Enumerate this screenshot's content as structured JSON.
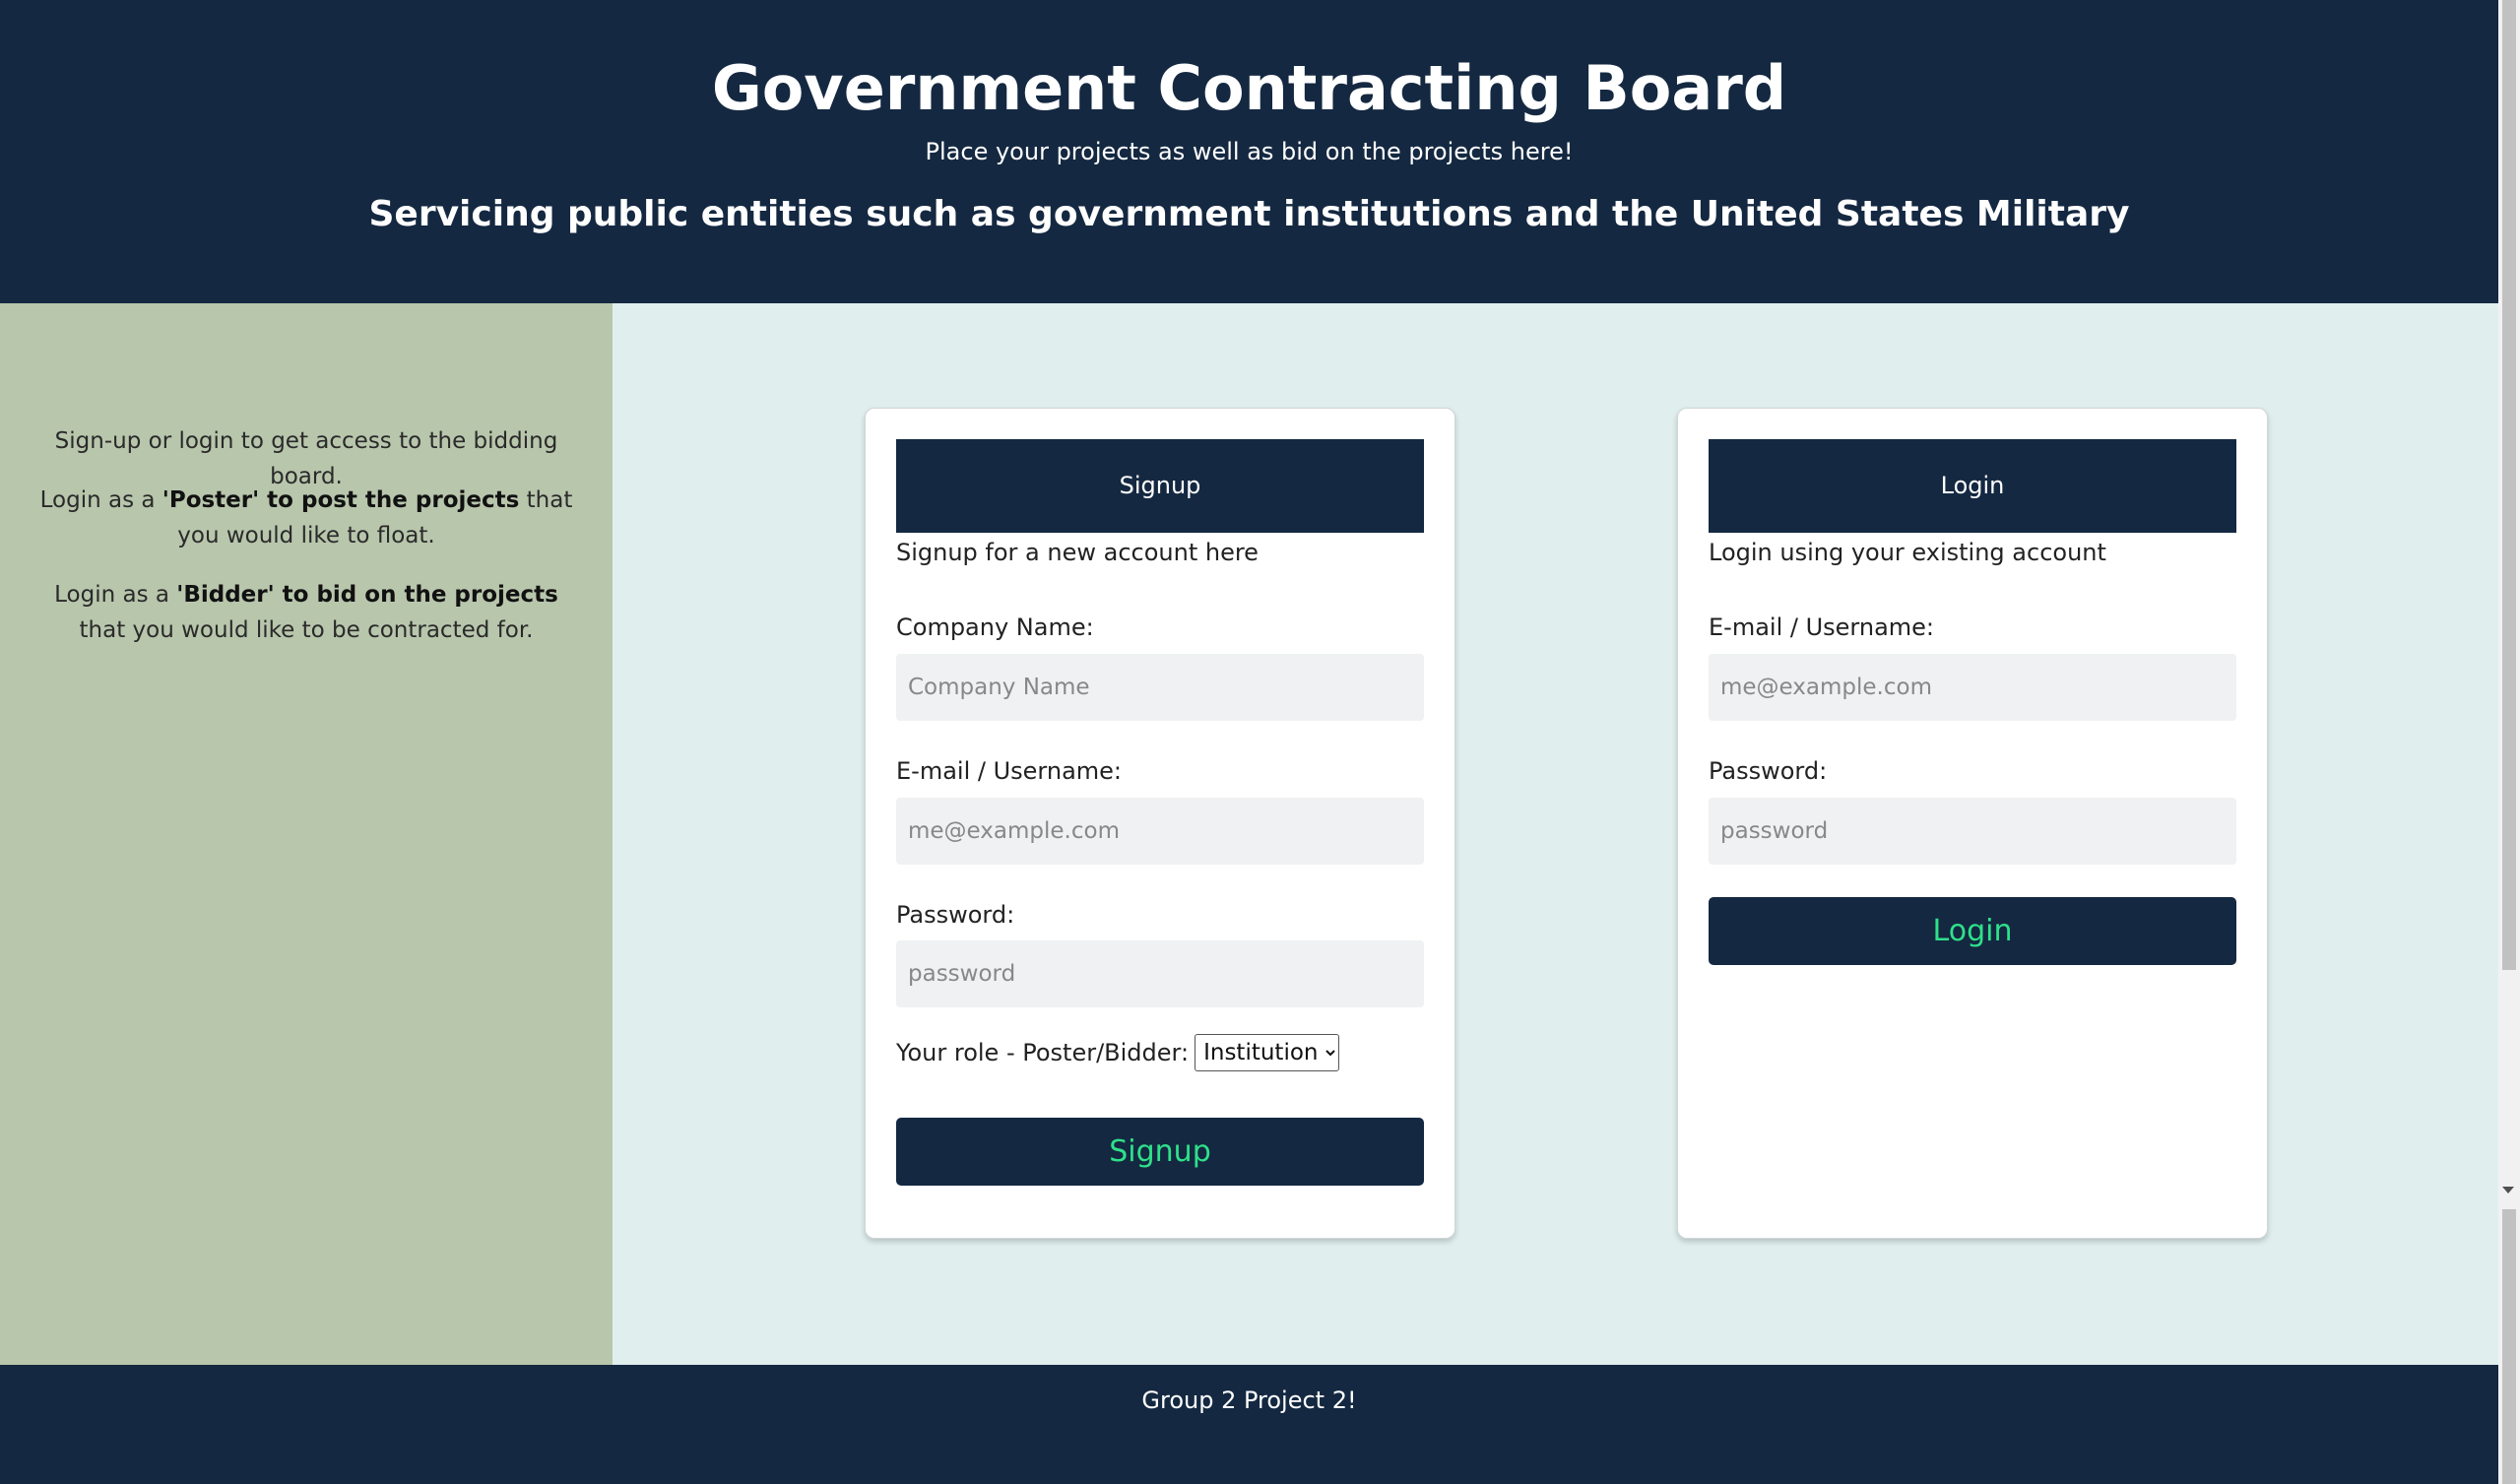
{
  "header": {
    "title": "Government Contracting Board",
    "tagline": "Place your projects as well as bid on the projects here!",
    "subheading": "Servicing public entities such as government institutions and the United States Military"
  },
  "sidebar": {
    "intro": "Sign-up or login to get access to the bidding board.",
    "poster_prefix": "Login as a ",
    "poster_bold": "'Poster' to post the projects",
    "poster_suffix": " that you would like to float.",
    "bidder_prefix": "Login as a ",
    "bidder_bold": "'Bidder' to bid on the projects",
    "bidder_suffix": " that you would like to be contracted for."
  },
  "signup": {
    "header": "Signup",
    "description": "Signup for a new account here",
    "company_label": "Company Name:",
    "company_placeholder": "Company Name",
    "email_label": "E-mail / Username:",
    "email_placeholder": "me@example.com",
    "password_label": "Password:",
    "password_placeholder": "password",
    "role_label": "Your role - Poster/Bidder:",
    "role_selected": "Institution",
    "button_label": "Signup"
  },
  "login": {
    "header": "Login",
    "description": "Login using your existing account",
    "email_label": "E-mail / Username:",
    "email_placeholder": "me@example.com",
    "password_label": "Password:",
    "password_placeholder": "password",
    "button_label": "Login"
  },
  "footer": {
    "text": "Group 2 Project 2!"
  },
  "colors": {
    "navy": "#142841",
    "sidebar_green": "#b8c6ac",
    "main_bg": "#e0eeee",
    "button_text_green": "#2fe08a"
  }
}
